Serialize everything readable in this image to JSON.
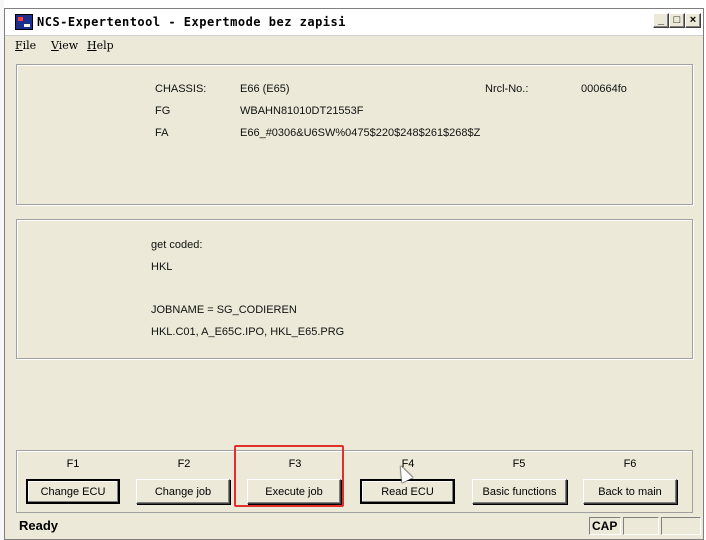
{
  "window": {
    "title": "NCS-Expertentool - Expertmode bez zapisi",
    "buttons": {
      "minimize": "_",
      "maximize": "□",
      "close": "×"
    }
  },
  "menu": [
    {
      "label_u": "F",
      "label_rest": "ile"
    },
    {
      "label_u": "V",
      "label_rest": "iew"
    },
    {
      "label_u": "H",
      "label_rest": "elp"
    }
  ],
  "info": {
    "chassis_label": "CHASSIS:",
    "chassis_value": "E66 (E65)",
    "nrcl_label": "Nrcl-No.:",
    "nrcl_value": "000664fo",
    "fg_label": "FG",
    "fg_value": "WBAHN81010DT21553F",
    "fa_label": "FA",
    "fa_value": "E66_#0306&U6SW%0475$220$248$261$268$Z"
  },
  "log": {
    "line1": "get coded:",
    "line2": "HKL",
    "line3": "JOBNAME = SG_CODIEREN",
    "line4": "HKL.C01, A_E65C.IPO, HKL_E65.PRG"
  },
  "fkeys": [
    {
      "key": "F1",
      "label": "Change ECU"
    },
    {
      "key": "F2",
      "label": "Change job"
    },
    {
      "key": "F3",
      "label": "Execute job"
    },
    {
      "key": "F4",
      "label": "Read ECU"
    },
    {
      "key": "F5",
      "label": "Basic functions"
    },
    {
      "key": "F6",
      "label": "Back to main"
    }
  ],
  "status": {
    "text": "Ready",
    "panel1": "CAP",
    "panel2": "",
    "panel3": ""
  },
  "colors": {
    "highlight": "#e0302c",
    "window_bg": "#ece9d8"
  }
}
